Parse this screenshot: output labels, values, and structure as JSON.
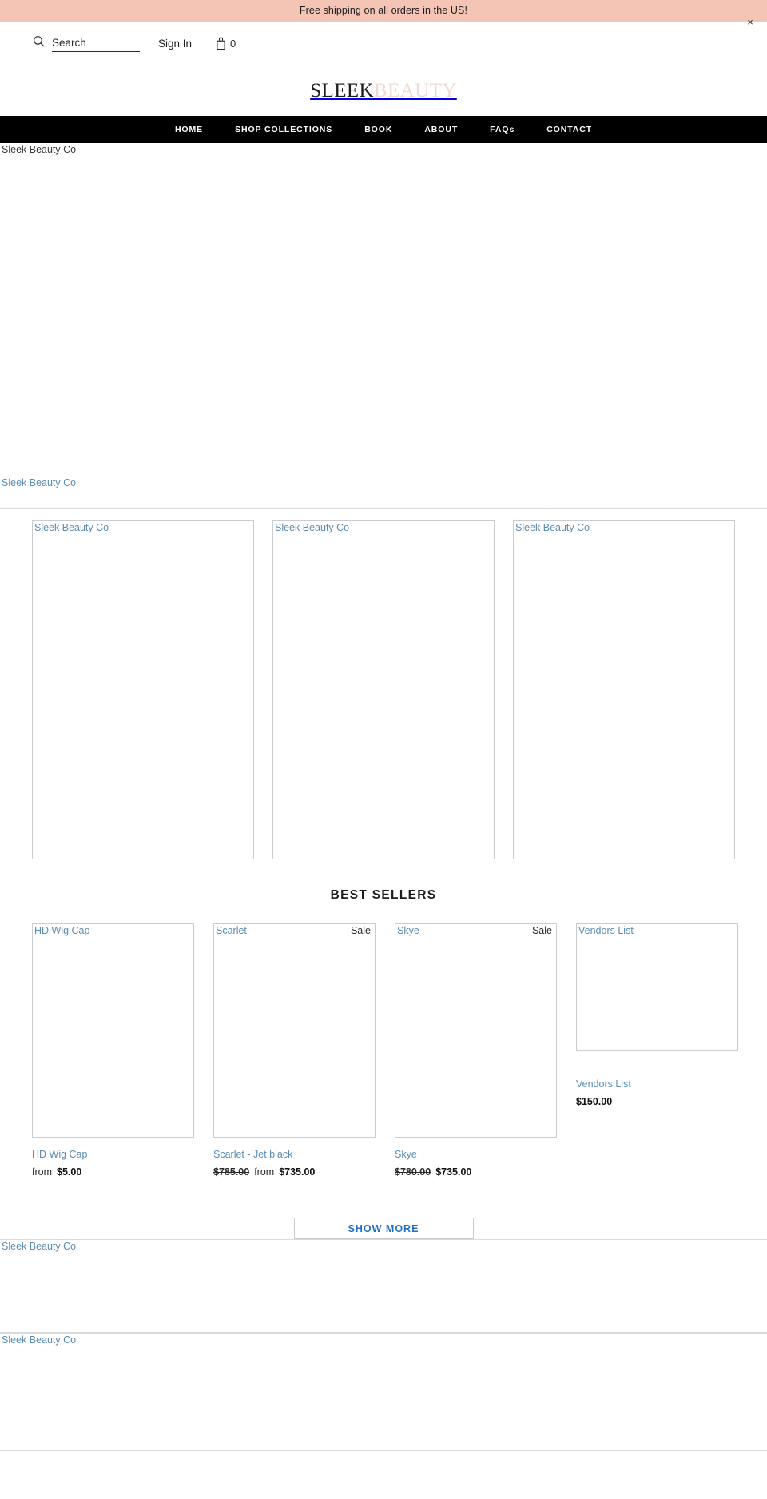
{
  "announcement": {
    "text": "Free shipping on all orders in the US!",
    "close_label": "×",
    "background": "#f4c4b4"
  },
  "utility_header": {
    "search": {
      "placeholder": "Search",
      "value": "",
      "icon": "search-icon"
    },
    "sign_in_label": "Sign In",
    "cart": {
      "icon": "shopping-bag-icon",
      "count": "0"
    }
  },
  "logo": {
    "part_one": "SLEEK",
    "part_two": "BEAUTY",
    "part_one_color": "#1c1c1c",
    "part_two_color": "#f0d9d0"
  },
  "main_nav": {
    "background": "#000000",
    "items": [
      {
        "label": "HOME"
      },
      {
        "label": "SHOP COLLECTIONS"
      },
      {
        "label": "BOOK"
      },
      {
        "label": "ABOUT"
      },
      {
        "label": "FAQs"
      },
      {
        "label": "CONTACT"
      }
    ]
  },
  "hero": {
    "alt_text": "Sleek Beauty Co"
  },
  "strip": {
    "alt_text": "Sleek Beauty Co"
  },
  "collection_row": {
    "cells": [
      {
        "alt_text": "Sleek Beauty Co"
      },
      {
        "alt_text": "Sleek Beauty Co"
      },
      {
        "alt_text": "Sleek Beauty Co"
      }
    ]
  },
  "best_sellers": {
    "heading": "BEST SELLERS",
    "products": [
      {
        "image_alt": "HD Wig Cap",
        "badge": "",
        "title": "HD Wig Cap",
        "price_prefix": "from",
        "price_old": "",
        "price_current": "$5.00"
      },
      {
        "image_alt": "Scarlet",
        "badge": "Sale",
        "title": "Scarlet - Jet black",
        "price_prefix": "from",
        "price_old": "$785.00",
        "price_current": "$735.00"
      },
      {
        "image_alt": "Skye",
        "badge": "Sale",
        "title": "Skye",
        "price_prefix": "",
        "price_old": "$780.00",
        "price_current": "$735.00"
      },
      {
        "image_alt": "Vendors List",
        "badge": "",
        "title": "Vendors List",
        "price_prefix": "",
        "price_old": "",
        "price_current": "$150.00"
      }
    ],
    "show_more_label": "SHOW MORE"
  },
  "bottom_bands": [
    {
      "alt_text": "Sleek Beauty Co"
    },
    {
      "alt_text": "Sleek Beauty Co"
    }
  ]
}
